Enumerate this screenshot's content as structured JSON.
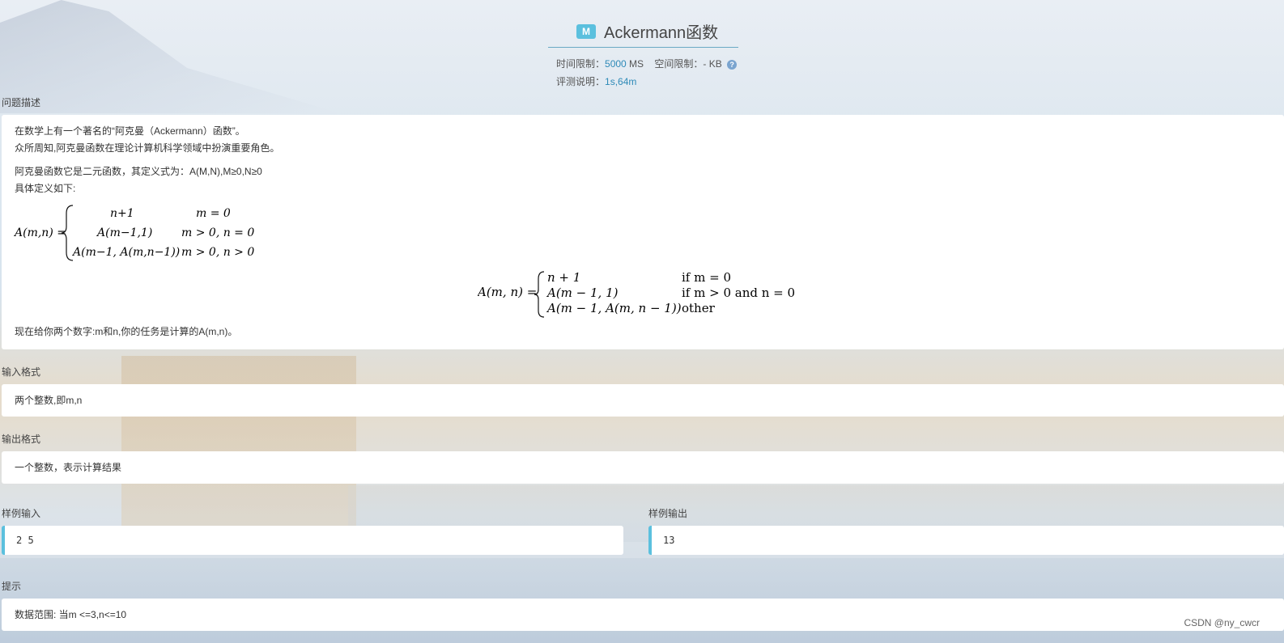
{
  "problem": {
    "badge": "M",
    "title": "Ackermann函数",
    "time_limit_label": "时间限制：",
    "time_limit_value": "5000",
    "time_limit_unit": " MS",
    "space_limit_label": "空间限制：",
    "space_limit_value": "-",
    "space_limit_unit": " KB",
    "judge_label": "评测说明：",
    "judge_value": "1s,64m"
  },
  "sections": {
    "description": {
      "label": "问题描述",
      "line1": "在数学上有一个著名的“阿克曼（Ackermann）函数”。",
      "line2": "众所周知,阿克曼函数在理论计算机科学领域中扮演重要角色。",
      "line3": "阿克曼函数它是二元函数，其定义式为：A(M,N),M≥0,N≥0",
      "line4": "具体定义如下:",
      "line5": "现在给你两个数字:m和n,你的任务是计算的A(m,n)。"
    },
    "input_format": {
      "label": "输入格式",
      "text": "两个整数,即m,n"
    },
    "output_format": {
      "label": "输出格式",
      "text": "一个整数，表示计算结果"
    },
    "sample_input": {
      "label": "样例输入",
      "text": "2 5"
    },
    "sample_output": {
      "label": "样例输出",
      "text": "13"
    },
    "hint": {
      "label": "提示",
      "text": "数据范围: 当m <=3,n<=10"
    }
  },
  "formula_image": {
    "lhs": "A(m,n) =",
    "case1_value": "n+1",
    "case1_cond": "m = 0",
    "case2_value": "A(m−1,1)",
    "case2_cond": "m > 0, n = 0",
    "case3_value": "A(m−1, A(m,n−1))",
    "case3_cond": "m > 0, n > 0"
  },
  "formula_math": {
    "lhs": "A(m, n) =",
    "case1_value": "n + 1",
    "case1_cond": "if  m = 0",
    "case2_value": "A(m − 1, 1)",
    "case2_cond": "if  m > 0  and  n = 0",
    "case3_value": "A(m − 1, A(m, n − 1))",
    "case3_cond": "other"
  },
  "watermark": "CSDN @ny_cwcr",
  "colors": {
    "accent": "#5bc0de",
    "link": "#2e8ab8"
  }
}
